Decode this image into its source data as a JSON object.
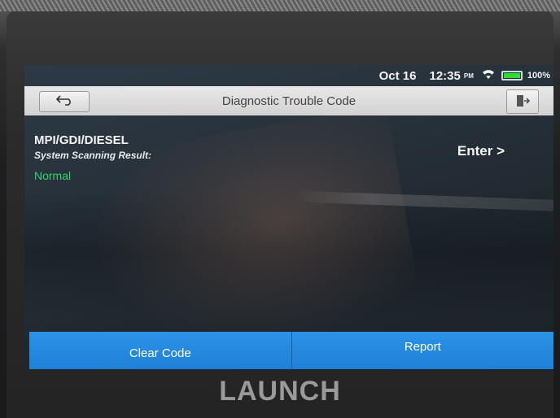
{
  "status_bar": {
    "date": "Oct 16",
    "time": "12:35",
    "ampm": "PM",
    "battery_percent": "100%",
    "battery_level": 1.0,
    "wifi_icon": "wifi-icon",
    "battery_icon": "battery-icon"
  },
  "title_bar": {
    "title": "Diagnostic Trouble Code",
    "back_icon": "back-arrow-icon",
    "exit_icon": "exit-icon"
  },
  "content": {
    "system_name": "MPI/GDI/DIESEL",
    "scan_label": "System Scanning Result:",
    "scan_result": "Normal",
    "enter_label": "Enter >"
  },
  "bottom_buttons": {
    "clear_code": "Clear Code",
    "report": "Report"
  },
  "device": {
    "brand": "LAUNCH"
  },
  "colors": {
    "accent_blue": "#2b93e8",
    "result_green": "#35d36b",
    "battery_green": "#2bdc33"
  }
}
